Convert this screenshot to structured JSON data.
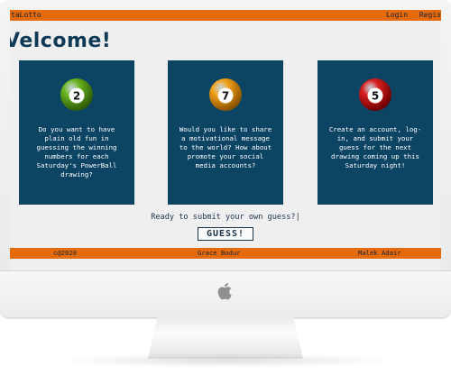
{
  "topbar": {
    "brand": "taLotto",
    "nav": [
      "Login",
      "Regis"
    ]
  },
  "welcome": "Velcome!",
  "cards": [
    {
      "ball_number": "2",
      "ball_color": "#6ab51f",
      "text": "Do you want to have plain old fun in guessing the winning numbers for each Saturday's PowerBall drawing?"
    },
    {
      "ball_number": "7",
      "ball_color": "#f1a21a",
      "text": "Would you like to share a motivational message to the world? How about promote your social media accounts?"
    },
    {
      "ball_number": "5",
      "ball_color": "#d91f1f",
      "text": "Create an account, log-in, and submit your guess for the next drawing coming up this Saturday night!"
    }
  ],
  "prompt": "Ready to submit your own guess?|",
  "guess_button": "GUESS!",
  "footer": {
    "left": "c@2020",
    "center": "Grace Bodur",
    "right": "Malek Adair"
  },
  "colors": {
    "accent": "#e56a0a",
    "card": "#0c4463",
    "text": "#0f3a55"
  }
}
